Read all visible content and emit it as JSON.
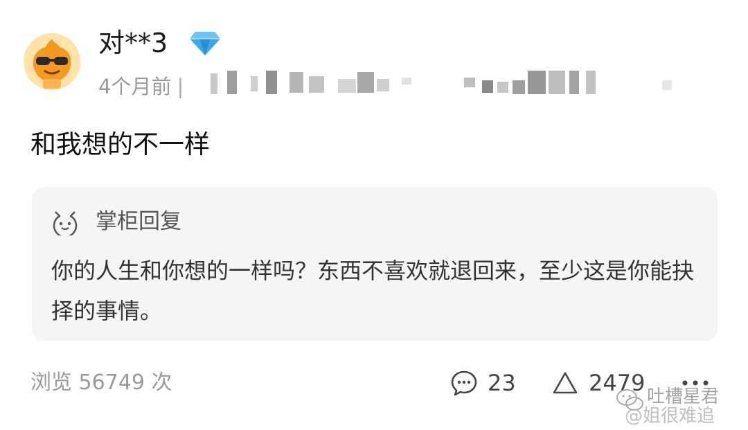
{
  "user": {
    "name": "对**3",
    "badge_icon": "diamond-icon",
    "time": "4个月前",
    "separator": "|"
  },
  "comment": {
    "text": "和我想的不一样"
  },
  "reply": {
    "icon": "smiley-icon",
    "title": "掌柜回复",
    "body": "你的人生和你想的一样吗？东西不喜欢就退回来，至少这是你能抉择的事情。"
  },
  "footer": {
    "views": "浏览 56749 次",
    "comment_count": "23",
    "like_count": "2479",
    "more_icon": "more-dots-icon"
  },
  "watermark": {
    "line1": "吐槽星君",
    "line2": "@姐很难追"
  },
  "colors": {
    "avatar_bg": "#fde3a9",
    "avatar_orange": "#f39a1f",
    "diamond": "#3aa8f0",
    "reply_bg": "#f5f5f5",
    "muted_text": "#9a9a9a"
  }
}
